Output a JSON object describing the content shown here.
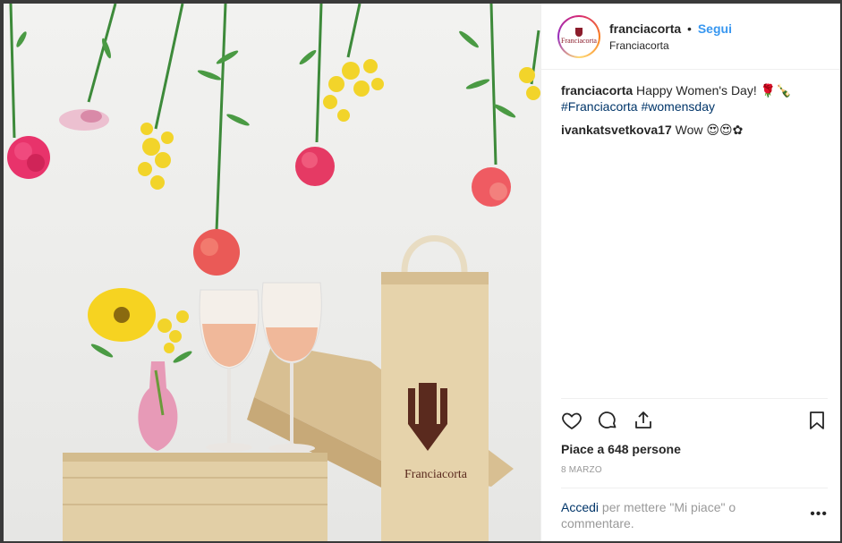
{
  "post": {
    "photo_alt": "",
    "box_logo_text": "Franciacorta"
  },
  "header": {
    "username": "franciacorta",
    "separator": "•",
    "follow_label": "Segui",
    "location": "Franciacorta",
    "avatar_text": "Franciacorta"
  },
  "comments": [
    {
      "user": "franciacorta",
      "text": "Happy Women's Day! 🌹🍾",
      "tags": [
        "#Franciacorta",
        "#womensday"
      ]
    },
    {
      "user": "ivankatsvetkova17",
      "text": "Wow 😍😍✿"
    }
  ],
  "actions": {
    "like_icon": "heart-icon",
    "comment_icon": "comment-icon",
    "share_icon": "share-icon",
    "save_icon": "bookmark-icon"
  },
  "likes_text": "Piace a 648 persone",
  "date_text": "8 marzo",
  "login": {
    "link": "Accedi",
    "rest": "per mettere \"Mi piace\" o commentare.",
    "more": "•••"
  },
  "colors": {
    "accent": "#3897f0",
    "link": "#003569",
    "muted": "#999999"
  }
}
